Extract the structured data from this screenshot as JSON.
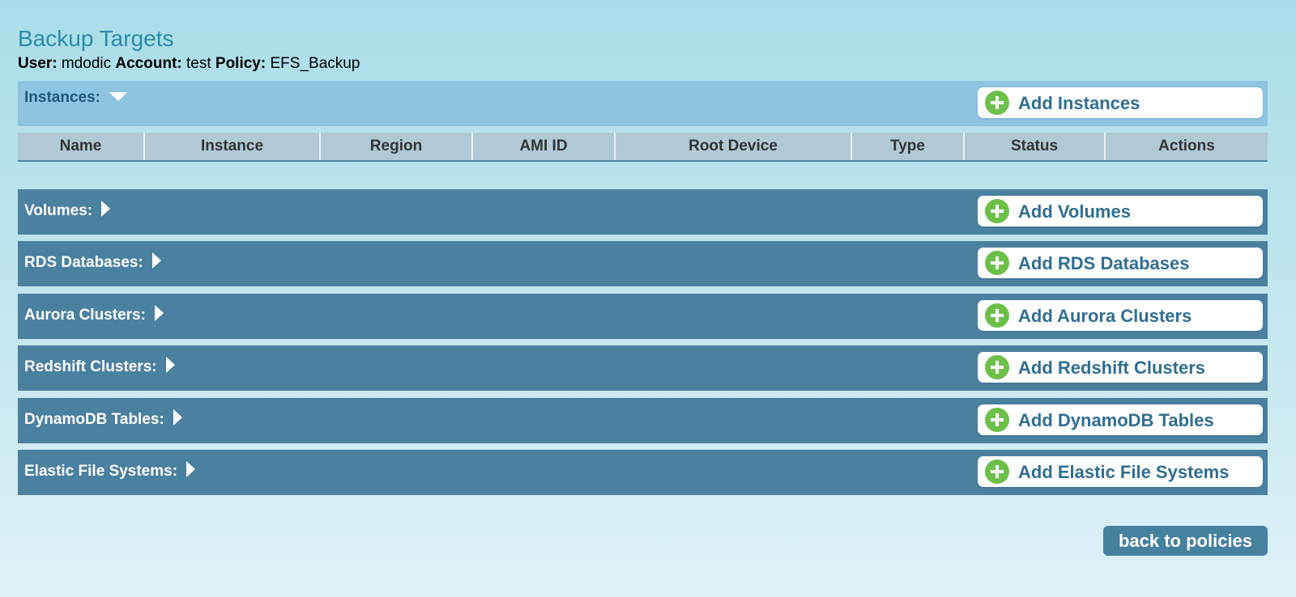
{
  "page": {
    "title": "Backup Targets"
  },
  "context": {
    "user_key": "User:",
    "user_value": "mdodic",
    "account_key": "Account:",
    "account_value": "test",
    "policy_key": "Policy:",
    "policy_value": "EFS_Backup"
  },
  "instances": {
    "label": "Instances:",
    "toggle_icon": "triangle-down-icon",
    "add_label": "Add Instances",
    "table_headers": [
      "Name",
      "Instance",
      "Region",
      "AMI ID",
      "Root Device",
      "Type",
      "Status",
      "Actions"
    ]
  },
  "sections": [
    {
      "label": "Volumes:",
      "add_label": "Add Volumes"
    },
    {
      "label": "RDS Databases:",
      "add_label": "Add RDS Databases"
    },
    {
      "label": "Aurora Clusters:",
      "add_label": "Add Aurora Clusters"
    },
    {
      "label": "Redshift Clusters:",
      "add_label": "Add Redshift Clusters"
    },
    {
      "label": "DynamoDB Tables:",
      "add_label": "Add DynamoDB Tables"
    },
    {
      "label": "Elastic File Systems:",
      "add_label": "Add Elastic File Systems"
    }
  ],
  "back_button": "back to policies",
  "colors": {
    "title": "#2b8bab",
    "instances_bar": "#8ec4e2",
    "section_bar": "#4a80a0",
    "add_text": "#2f6e92",
    "plus_icon": "#6cc04a"
  }
}
